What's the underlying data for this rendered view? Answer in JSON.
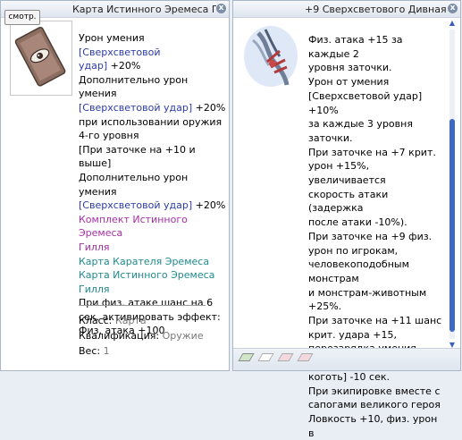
{
  "left_window": {
    "title": "Карта Истинного Эремеса Ги...",
    "view_button": "смотр.",
    "close_glyph": "x",
    "desc": [
      {
        "lines": [
          [
            {
              "t": "Урон умения "
            },
            {
              "t": "[Сверхсветовой",
              "c": "blue"
            }
          ],
          [
            {
              "t": "удар]",
              "c": "blue"
            },
            {
              "t": " +20%"
            }
          ],
          [
            {
              "t": "Дополнительно урон умения"
            }
          ],
          [
            {
              "t": "[Сверхсветовой удар]",
              "c": "blue"
            },
            {
              "t": " +20%"
            }
          ],
          [
            {
              "t": "при использовании оружия"
            }
          ],
          [
            {
              "t": "4-го уровня"
            }
          ],
          [
            {
              "t": "[При заточке на +10 и"
            }
          ],
          [
            {
              "t": "выше]"
            }
          ],
          [
            {
              "t": "Дополнительно урон умения"
            }
          ],
          [
            {
              "t": "[Сверхсветовой удар]",
              "c": "blue"
            },
            {
              "t": " +20%"
            }
          ],
          [
            {
              "t": "Комплект Истинного Эремеса",
              "c": "purple"
            }
          ],
          [
            {
              "t": "Гилля",
              "c": "purple"
            }
          ],
          [
            {
              "t": "Карта Карателя Эремеса",
              "c": "teal"
            }
          ],
          [
            {
              "t": "Карта Истинного Эремеса",
              "c": "teal"
            }
          ],
          [
            {
              "t": "Гилля",
              "c": "teal"
            }
          ],
          [
            {
              "t": "При физ. атаке шанс на 6"
            }
          ],
          [
            {
              "t": "сек. активировать эффект:"
            }
          ],
          [
            {
              "t": "Физ. атака +100"
            }
          ]
        ]
      }
    ],
    "meta": {
      "class_label": "Класс:",
      "class_value": "Карта",
      "qual_label": "Квалификация:",
      "qual_value": "Оружие",
      "weight_label": "Вес:",
      "weight_value": "1"
    }
  },
  "right_window": {
    "title": "+9 Сверхсветового Дивная Дл...",
    "close_glyph": "x",
    "desc": [
      {
        "lines": [
          [
            {
              "t": "Физ. атака +15 за каждые 2"
            }
          ],
          [
            {
              "t": "уровня заточки."
            }
          ],
          [
            {
              "t": "Урон от умения"
            }
          ],
          [
            {
              "t": "[Сверхсветовой удар] +10%"
            }
          ],
          [
            {
              "t": "за каждые 3 уровня"
            }
          ],
          [
            {
              "t": "заточки."
            }
          ],
          [
            {
              "t": "При заточке на +7 крит."
            }
          ],
          [
            {
              "t": "урон +15%, увеличивается"
            }
          ],
          [
            {
              "t": "скорость атаки (задержка"
            }
          ],
          [
            {
              "t": "после атаки -10%)."
            }
          ],
          [
            {
              "t": "При заточке на +9 физ."
            }
          ],
          [
            {
              "t": "урон по игрокам,"
            }
          ],
          [
            {
              "t": "человекоподобным монстрам"
            }
          ],
          [
            {
              "t": "и монстрам-животным +25%."
            }
          ],
          [
            {
              "t": "При заточке на +11 шанс"
            }
          ],
          [
            {
              "t": "крит. удара +15,"
            }
          ],
          [
            {
              "t": "перезарядка умения [Черный"
            }
          ],
          [
            {
              "t": "коготь] -10 сек."
            }
          ],
          [
            {
              "t": "При экипировке вместе с"
            }
          ],
          [
            {
              "t": "сапогами великого героя"
            }
          ],
          [
            {
              "t": "Ловкость +10, физ. урон в"
            }
          ]
        ]
      }
    ]
  },
  "colors": {
    "blue": "#2b3aa6",
    "purple": "#a52fa6",
    "teal": "#1f8a8d",
    "grey": "#777777",
    "scroll": "#3d68c4"
  },
  "icons": [
    "close-icon",
    "card-eye-icon",
    "weapon-claw-icon",
    "scroll-up-icon",
    "scroll-down-icon",
    "card-slot-icon"
  ]
}
